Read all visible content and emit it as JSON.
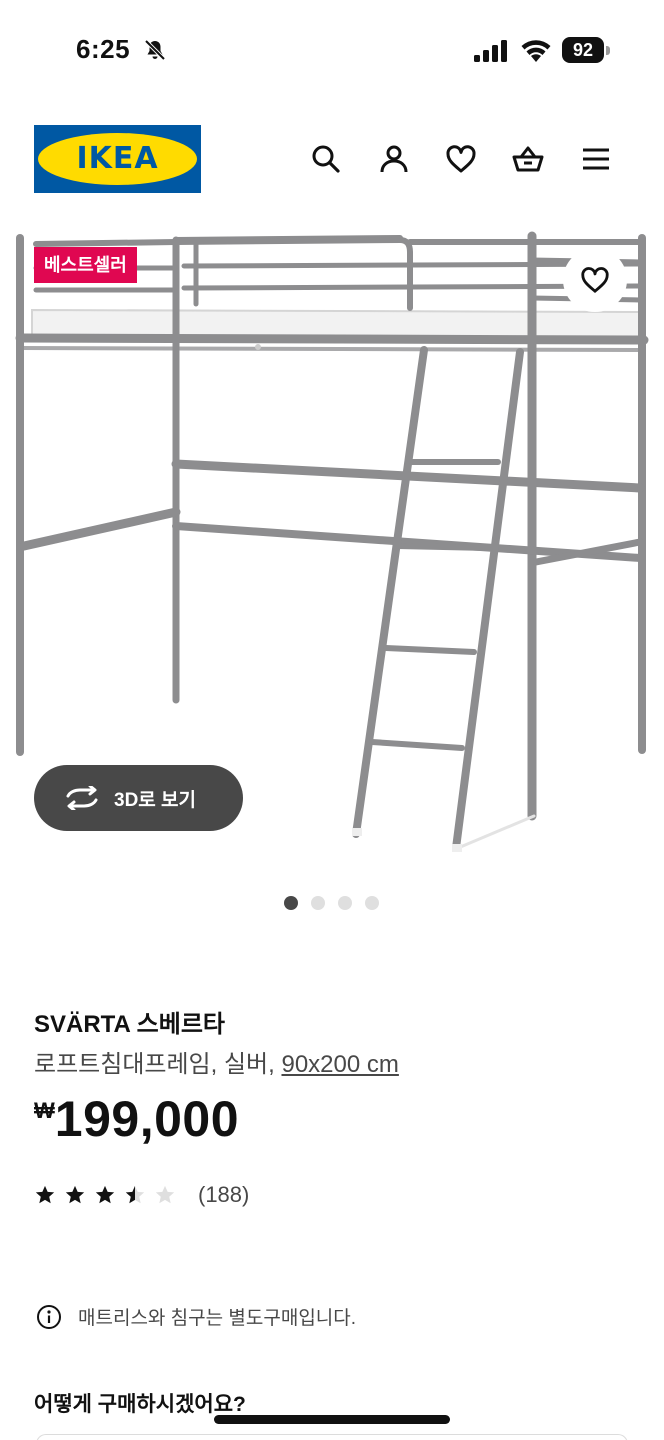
{
  "status_bar": {
    "time": "6:25",
    "battery": "92"
  },
  "header": {
    "logo_text": "IKEA",
    "brand_colors": {
      "blue": "#0058a3",
      "yellow": "#ffdb00"
    },
    "icons": [
      "search-icon",
      "user-icon",
      "heart-icon",
      "basket-icon",
      "menu-icon"
    ]
  },
  "gallery": {
    "badge": "베스트셀러",
    "badge_color": "#e00751",
    "view_3d_label": "3D로 보기",
    "image_count": 4,
    "active_image": 1
  },
  "product": {
    "name": "SVÄRTA 스베르타",
    "description": "로프트침대프레임, 실버, ",
    "size": "90x200 cm",
    "currency": "₩",
    "price": "199,000",
    "rating": 3.5,
    "rating_max": 5,
    "review_count": "(188)"
  },
  "notice": {
    "text": "매트리스와 침구는 별도구매입니다."
  },
  "purchase_section": {
    "title": "어떻게 구매하시겠어요?"
  }
}
